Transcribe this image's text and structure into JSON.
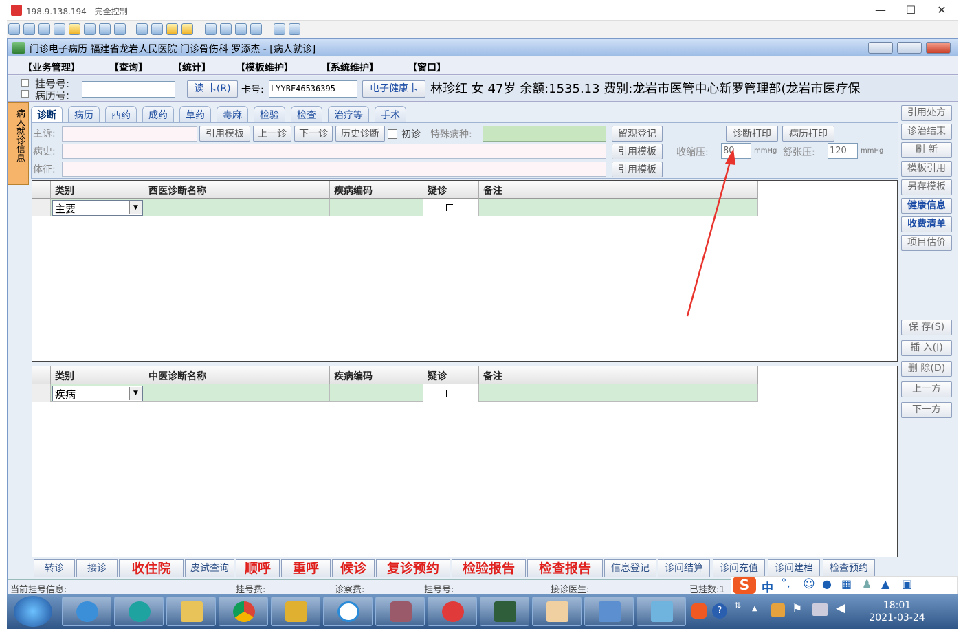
{
  "rdp": {
    "title": "198.9.138.194 - 完全控制",
    "minimize": "—",
    "maximize": "☐",
    "close": "✕"
  },
  "app": {
    "title": "门诊电子病历  福建省龙岩人民医院  门诊骨伤科  罗添杰 - [病人就诊]"
  },
  "menu": [
    "【业务管理】",
    "【查询】",
    "【统计】",
    "【模板维护】",
    "【系统维护】",
    "【窗口】"
  ],
  "patient_bar": {
    "reg_no_label": "挂号号:",
    "record_no_label": "病历号:",
    "reg_no_value": "",
    "read_card": "读 卡(R)",
    "card_label": "卡号:",
    "card_value": "LYYBF46536395",
    "health_card": "电子健康卡",
    "info": "林珍红  女  47岁  余额:1535.13  费别:龙岩市医管中心新罗管理部(龙岩市医疗保"
  },
  "left_tab": "病人就诊信息",
  "tabs": [
    "诊断",
    "病历",
    "西药",
    "成药",
    "草药",
    "毒麻",
    "检验",
    "检查",
    "治疗等",
    "手术"
  ],
  "form": {
    "complaint_label": "主诉:",
    "history_label": "病史:",
    "sign_label": "体征:",
    "cite_template": "引用模板",
    "prev_visit": "上一诊",
    "next_visit": "下一诊",
    "history_diag": "历史诊断",
    "first_visit": "初诊",
    "special_label": "特殊病种:",
    "observe_reg": "留观登记",
    "diag_print": "诊断打印",
    "record_print": "病历打印",
    "systolic_label": "收缩压:",
    "systolic_value": "80",
    "diastolic_label": "舒张压:",
    "diastolic_value": "120",
    "unit": "mmHg"
  },
  "western_grid": {
    "headers": [
      "类别",
      "西医诊断名称",
      "疾病编码",
      "疑诊",
      "备注"
    ],
    "row": {
      "type": "主要",
      "name": "",
      "code": "",
      "suspect": "",
      "note": ""
    }
  },
  "chinese_grid": {
    "headers": [
      "类别",
      "中医诊断名称",
      "疾病编码",
      "疑诊",
      "备注"
    ],
    "row": {
      "type": "疾病",
      "name": "",
      "code": "",
      "suspect": "",
      "note": ""
    }
  },
  "right_panel": [
    "引用处方",
    "诊治结束",
    "刷 新",
    "模板引用",
    "另存模板",
    "健康信息",
    "收费清单",
    "项目估价"
  ],
  "right_panel_lower": [
    "保 存(S)",
    "插 入(I)",
    "删 除(D)",
    "上一方",
    "下一方"
  ],
  "bottom_buttons": [
    "转诊",
    "接诊",
    "收住院",
    "皮试查询",
    "顺呼",
    "重呼",
    "候诊",
    "复诊预约",
    "检验报告",
    "检查报告",
    "信息登记",
    "诊间结算",
    "诊间充值",
    "诊间建档",
    "检查预约"
  ],
  "status": {
    "current_reg": "当前挂号信息:",
    "reg_fee": "挂号费:",
    "exam_fee": "诊察费:",
    "reg_no": "挂号号:",
    "doctor": "接诊医生:",
    "registered": "已挂数:1"
  },
  "ime": {
    "logo": "S",
    "lang": "中"
  },
  "taskbar": {
    "time": "18:01",
    "date": "2021-03-24"
  },
  "colors": {
    "accent_red": "#e0201c",
    "grid_row": "#d3ecd6",
    "annotation_arrow": "#e8342c"
  }
}
